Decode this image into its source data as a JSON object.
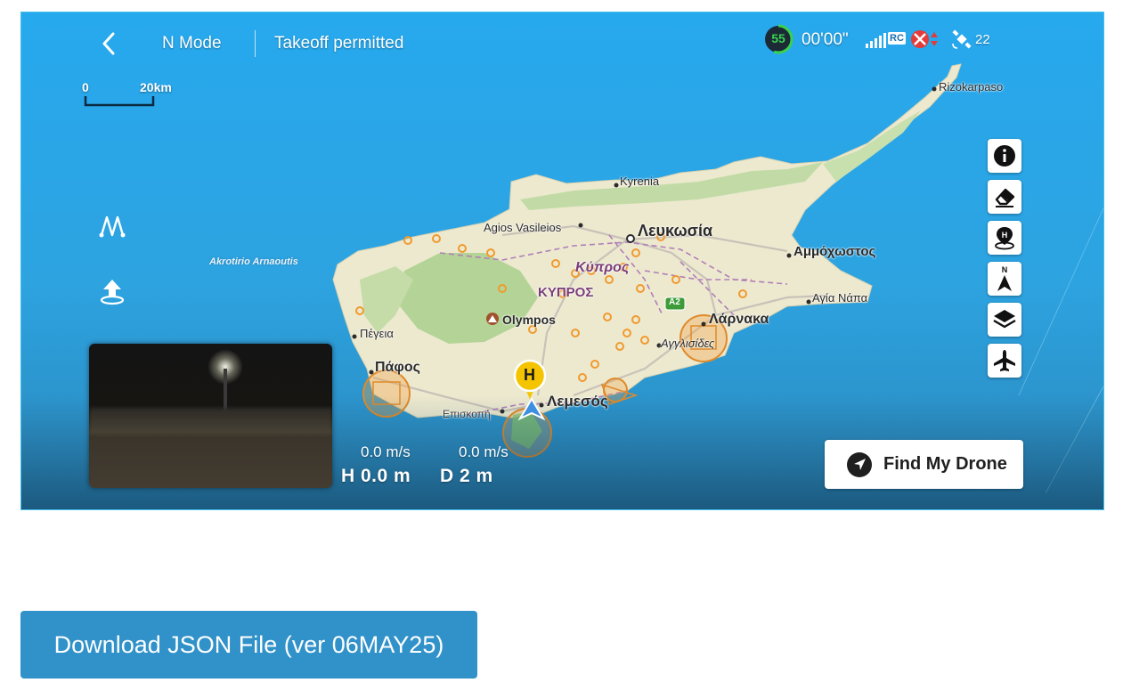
{
  "hud": {
    "flight_mode": "N Mode",
    "takeoff_status": "Takeoff permitted",
    "battery_percent": "55",
    "flight_time": "00'00\"",
    "rc_label": "RC",
    "satellite_count": "22",
    "scale_zero": "0",
    "scale_distance": "20km",
    "horizontal_speed": "0.0 m/s",
    "vertical_speed": "0.0 m/s",
    "height": "H 0.0 m",
    "distance": "D 2 m",
    "home_point_label": "H",
    "compass_north": "N",
    "find_drone_label": "Find My Drone"
  },
  "map": {
    "labels": {
      "rizokarpaso": "Rizokarpaso",
      "kyrenia": "Kyrenia",
      "agios_vasileios": "Agios Vasileios",
      "lefkosia": "Λευκωσία",
      "ammochostos": "Αμμόχωστος",
      "akrotirio_arnaoutis": "Akrotirio Arnaoutis",
      "kypros_lower": "Κύπρος",
      "kypros_upper": "ΚΥΠΡΟΣ",
      "agia_napa": "Αγία Νάπα",
      "highway": "A2",
      "olympos": "Olympos",
      "larnaka": "Λάρνακα",
      "pegeia": "Πέγεια",
      "agglisides": "Αγγλισίδες",
      "pafos": "Πάφος",
      "lemesos": "Λεμεσός",
      "episkopi": "Επισκοπή"
    }
  },
  "download": {
    "label": "Download JSON File (ver 06MAY25)"
  },
  "colors": {
    "sea": "#2ea6e6",
    "land": "#ece9cf",
    "forest": "#a8cd8a",
    "zone_orange": "#f0a030",
    "button_blue": "#3192c9"
  }
}
